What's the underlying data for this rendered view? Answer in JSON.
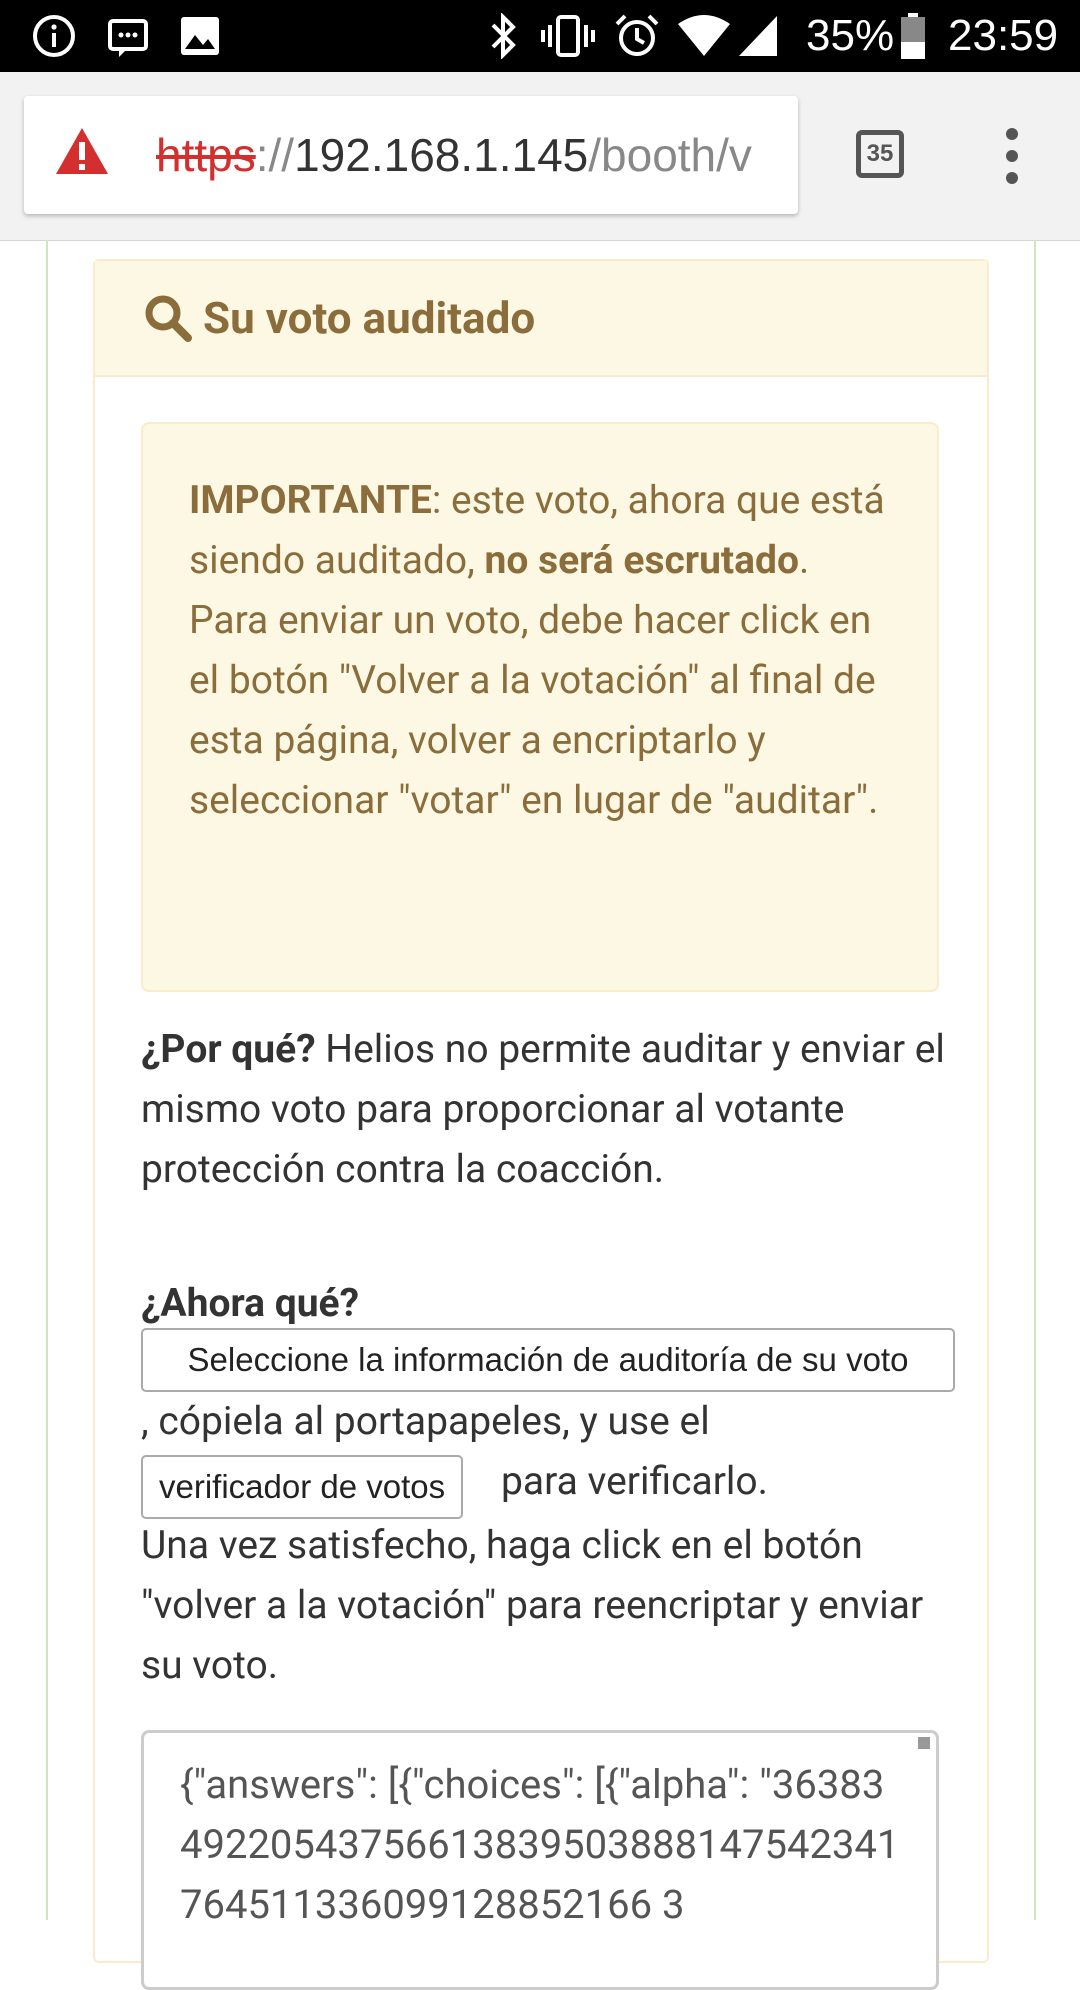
{
  "status_bar": {
    "battery_percent": "35%",
    "time": "23:59",
    "icons": [
      "info-icon",
      "message-icon",
      "image-icon",
      "bluetooth-icon",
      "vibrate-icon",
      "alarm-icon",
      "wifi-icon",
      "signal-icon",
      "battery-icon"
    ]
  },
  "browser": {
    "url_scheme": "https",
    "url_separator": "://",
    "url_host": "192.168.1.145",
    "url_path": "/booth/v",
    "tab_count": "35"
  },
  "panel": {
    "title": "Su voto auditado",
    "colors": {
      "heading_bg": "#fcf8e3",
      "heading_text": "#8a6d3b",
      "border": "#faebcc"
    }
  },
  "alert": {
    "important_label": "IMPORTANTE",
    "text_1": ": este voto, ahora que está siendo auditado, ",
    "bold_1": "no será escrutado",
    "text_2": ".",
    "text_3": "Para enviar un voto, debe hacer click en el botón \"Volver a la votación\" al final de esta página, volver a encriptarlo y seleccionar \"votar\" en lugar de \"auditar\"."
  },
  "why": {
    "label": "¿Por qué?",
    "text": " Helios no permite auditar y enviar el mismo voto para proporcionar al votante protección contra la coacción."
  },
  "now": {
    "label": "¿Ahora qué?",
    "select_button": "Seleccione la información de auditoría de su voto",
    "copy_text": ", cópiela al portapapeles, y use el",
    "verifier_button": "verificador de votos",
    "verify_text": "para verificarlo.",
    "once_text": "Una vez satisfecho, haga click en el botón \"volver a la votación\" para reencriptar y enviar su voto."
  },
  "audit_json": "{\"answers\": [{\"choices\": [{\"alpha\": \"3638349220543756613839503888147542341764511336099128852166 3"
}
